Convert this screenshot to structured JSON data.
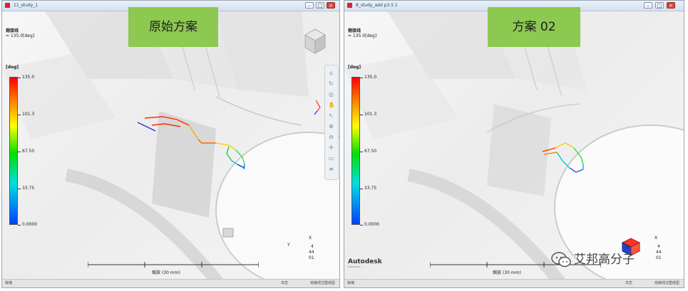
{
  "windows": [
    {
      "title": "11_study_1",
      "controls": {
        "minimize": "–",
        "maximize": "□",
        "close": "×"
      },
      "legend_title": "熔接线",
      "legend_subtitle": "= 135.0[deg]",
      "unit": "[deg]",
      "ticks": [
        "135.0",
        "101.3",
        "67.50",
        "33.75",
        "0.0000"
      ],
      "scale_label": "缩放 (30 mm)",
      "triad": [
        "X",
        "Y",
        "4",
        "44",
        "01"
      ],
      "status": {
        "left": "就绪",
        "mid": "日志",
        "right": "熔接线注塑成型"
      },
      "overlay_label": "原始方案"
    },
    {
      "title": "8_study_add p3.5 1",
      "controls": {
        "minimize": "–",
        "maximize": "□",
        "close": "×"
      },
      "legend_title": "熔接线",
      "legend_subtitle": "= 135.0[deg]",
      "unit": "[deg]",
      "ticks": [
        "135.0",
        "101.3",
        "67.50",
        "33.75",
        "0.0000"
      ],
      "scale_label": "缩放 (30 mm)",
      "triad": [
        "X",
        "Y",
        "4",
        "44",
        "01"
      ],
      "status": {
        "left": "就绪",
        "mid": "日志",
        "right": "熔接线注塑成型"
      },
      "overlay_label": "方案 02",
      "brand": "Autodesk",
      "brand_sub": "MOLDFLOW"
    }
  ],
  "watermark": "艾邦高分子",
  "colors": {
    "label_bg": "#8dc850",
    "colorbar_top": "#ff0000",
    "colorbar_bottom": "#0040ff"
  }
}
